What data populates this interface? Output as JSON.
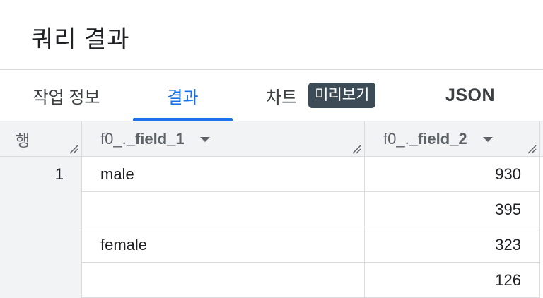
{
  "page": {
    "title": "쿼리 결과"
  },
  "tabs": {
    "job_info": "작업 정보",
    "results": "결과",
    "chart": "차트",
    "chart_badge": "미리보기",
    "json": "JSON",
    "active": "results"
  },
  "table": {
    "row_header": "행",
    "columns": [
      {
        "prefix": "f0_.",
        "name": "_field_1"
      },
      {
        "prefix": "f0_.",
        "name": "_field_2"
      }
    ],
    "rows": [
      {
        "row": "1",
        "f1": "male",
        "f2": "930"
      },
      {
        "row": "",
        "f1": "",
        "f2": "395"
      },
      {
        "row": "",
        "f1": "female",
        "f2": "323"
      },
      {
        "row": "",
        "f1": "",
        "f2": "126"
      }
    ]
  },
  "colors": {
    "accent": "#1a73e8",
    "badge_bg": "#3c4b55",
    "header_bg": "#f1f3f4",
    "border": "#dadce0"
  }
}
